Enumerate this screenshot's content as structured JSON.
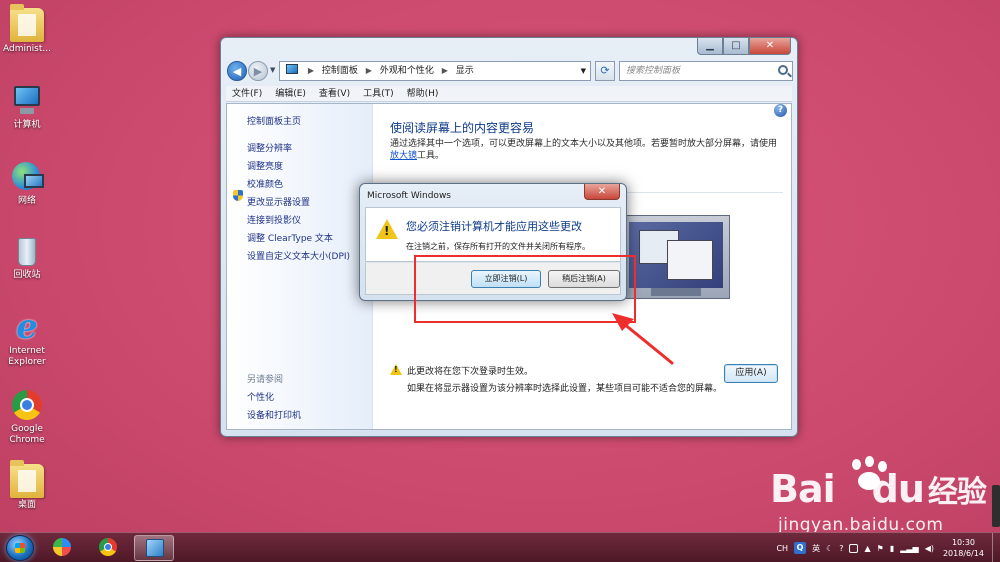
{
  "desktop_icons": [
    {
      "label": "Administ...",
      "icon": "folder-icon"
    },
    {
      "label": "计算机",
      "icon": "computer-icon"
    },
    {
      "label": "网络",
      "icon": "network-icon"
    },
    {
      "label": "回收站",
      "icon": "recycle-bin-icon"
    },
    {
      "label": "Internet Explorer",
      "icon": "internet-explorer-icon"
    },
    {
      "label": "Google Chrome",
      "icon": "chrome-icon"
    },
    {
      "label": "桌面",
      "icon": "folder-icon"
    }
  ],
  "window": {
    "controls": {
      "minimize": "▁",
      "maximize": "□",
      "close": "✕"
    },
    "address": {
      "segments": [
        "控制面板",
        "外观和个性化",
        "显示"
      ]
    },
    "search_placeholder": "搜索控制面板",
    "menu": [
      "文件(F)",
      "编辑(E)",
      "查看(V)",
      "工具(T)",
      "帮助(H)"
    ],
    "sidebar": {
      "home": "控制面板主页",
      "links": [
        "调整分辨率",
        "调整亮度",
        "校准颜色",
        "更改显示器设置",
        "连接到投影仪",
        "调整 ClearType 文本",
        "设置自定义文本大小(DPI)"
      ],
      "see_also_title": "另请参阅",
      "see_also": [
        "个性化",
        "设备和打印机"
      ]
    },
    "main": {
      "title": "使阅读屏幕上的内容更容易",
      "description_start": "通过选择其中一个选项，可以更改屏幕上的文本大小以及其他项。若要暂时放大部分屏幕，请使用",
      "description_link": "放大镜",
      "description_end": "工具。",
      "notice_line1": "此更改将在您下次登录时生效。",
      "notice_line2": "如果在将显示器设置为该分辨率时选择此设置，某些项目可能不适合您的屏幕。",
      "apply_button": "应用(A)"
    }
  },
  "dialog": {
    "title": "Microsoft Windows",
    "close": "✕",
    "heading": "您必须注销计算机才能应用这些更改",
    "subtext": "在注销之前，保存所有打开的文件并关闭所有程序。",
    "primary_button": "立即注销(L)",
    "secondary_button": "稍后注销(A)"
  },
  "watermark": {
    "brand": "Bai",
    "brand_mid": "du",
    "brand_cn": "经验",
    "url": "jingyan.baidu.com"
  },
  "taskbar": {
    "tray": {
      "lang": "CH",
      "q": "Q",
      "ime": "英",
      "clock_time": "10:30",
      "clock_date": "2018/6/14"
    }
  },
  "colors": {
    "desktop": "#cc4a6e",
    "annotation": "#ee2d2d",
    "link": "#1e3287",
    "heading": "#0c3a8a"
  }
}
